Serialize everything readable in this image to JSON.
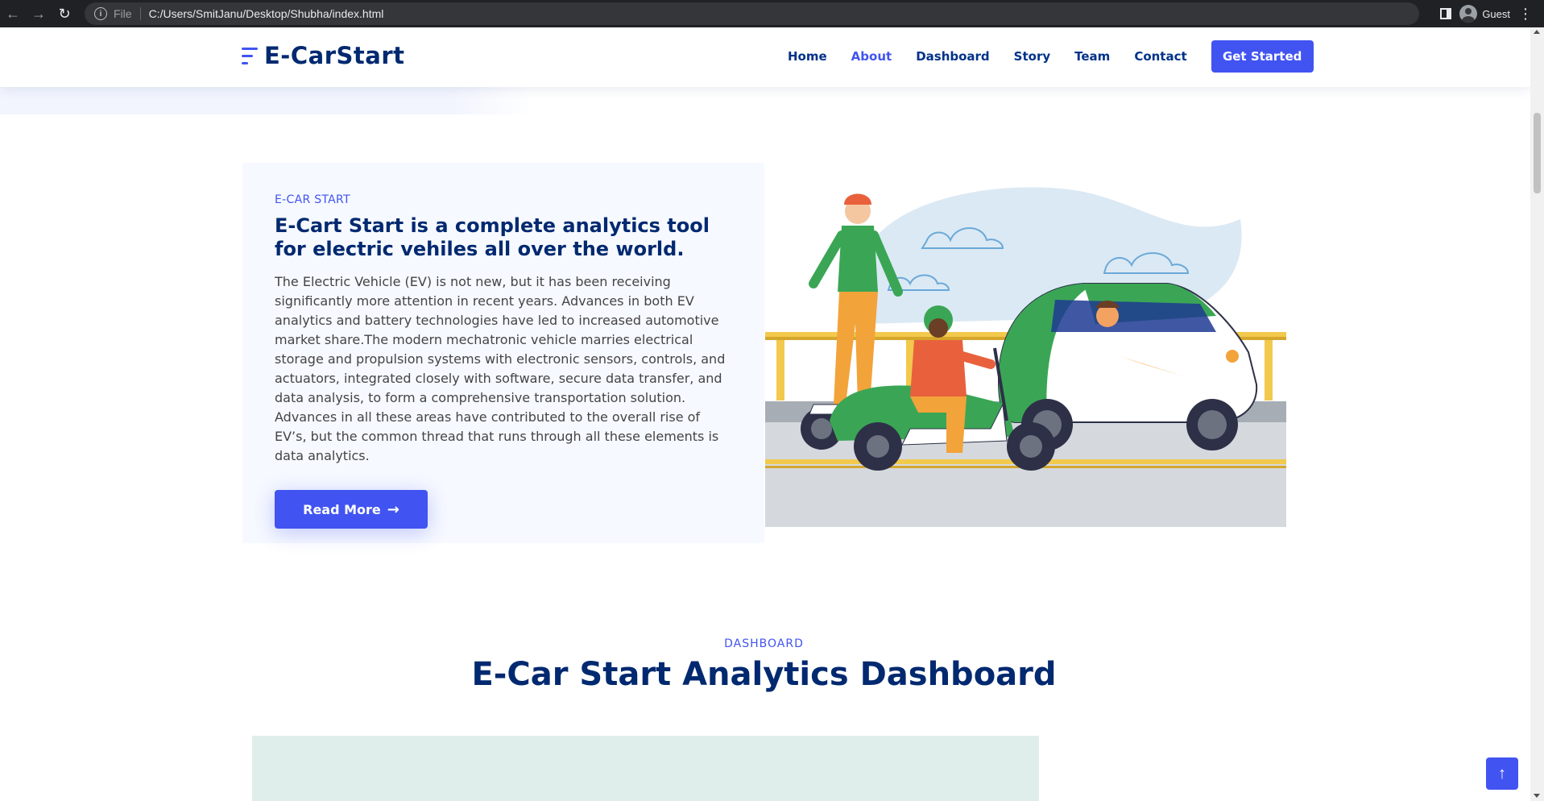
{
  "browser": {
    "scheme": "File",
    "url": "C:/Users/SmitJanu/Desktop/Shubha/index.html",
    "profile": "Guest"
  },
  "header": {
    "brand": "E-CarStart",
    "nav": [
      {
        "label": "Home",
        "active": false
      },
      {
        "label": "About",
        "active": true
      },
      {
        "label": "Dashboard",
        "active": false
      },
      {
        "label": "Story",
        "active": false
      },
      {
        "label": "Team",
        "active": false
      },
      {
        "label": "Contact",
        "active": false
      }
    ],
    "cta": "Get Started"
  },
  "about": {
    "eyebrow": "E-CAR START",
    "title": "E-Cart Start is a complete analytics tool for electric vehiles all over the world.",
    "text": "The Electric Vehicle (EV) is not new, but it has been receiving significantly more attention in recent years. Advances in both EV analytics and battery technologies have led to increased automotive market share.The modern mechatronic vehicle marries electrical storage and propulsion systems with electronic sensors, controls, and actuators, integrated closely with software, secure data transfer, and data analysis, to form a comprehensive transportation solution. Advances in all these areas have contributed to the overall rise of EV’s, but the common thread that runs through all these elements is data analytics.",
    "button": "Read More"
  },
  "dashboard": {
    "eyebrow": "DASHBOARD",
    "title": "E-Car Start Analytics Dashboard"
  },
  "colors": {
    "accent": "#4154f1",
    "heading": "#012970",
    "nav": "#013289",
    "aboutBg": "#f6f9ff",
    "dashFrame": "#dfeeeb"
  }
}
